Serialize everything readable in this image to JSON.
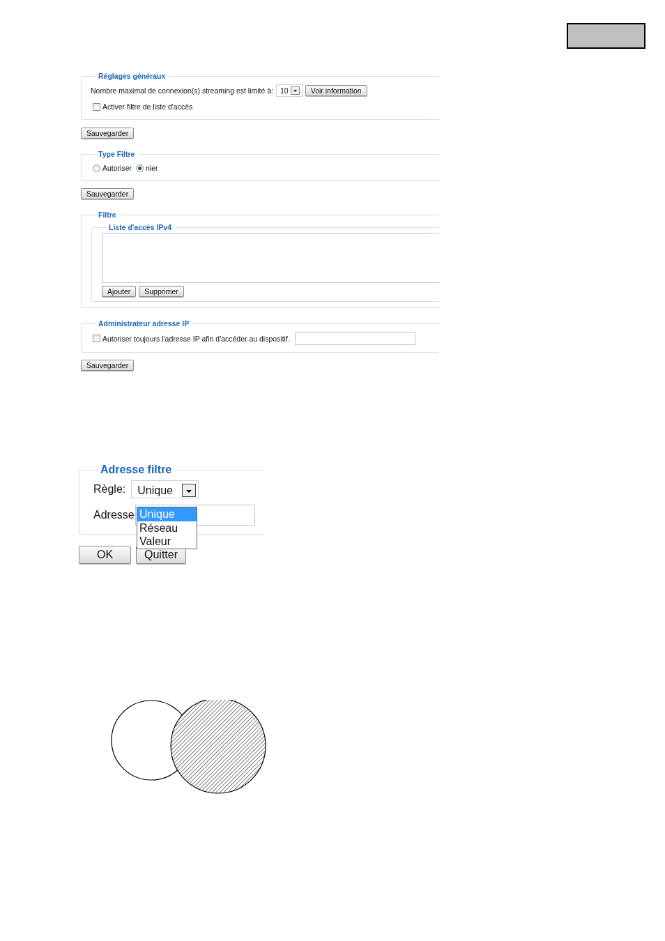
{
  "general_settings": {
    "title": "Réglages généraux",
    "max_connections_label": "Nombre maximal de connexion(s) streaming est limité à:",
    "max_connections_value": "10",
    "info_button": "Voir information",
    "access_filter": {
      "label": "Activer filtre de liste d'accès",
      "checked": false
    },
    "save_button": "Sauvegarder"
  },
  "filter_type": {
    "title": "Type Filtre",
    "options": [
      {
        "label": "Autoriser",
        "selected": false
      },
      {
        "label": "nier",
        "selected": true
      }
    ],
    "save_button": "Sauvegarder"
  },
  "filter": {
    "title": "Filtre",
    "ipv4_list": {
      "title": "Liste d'accès IPv4",
      "buttons": [
        "Ajouter",
        "Supprimer"
      ]
    }
  },
  "admin_ip": {
    "title": "Administrateur adresse IP",
    "always_allow": {
      "label": "Autoriser toujours l'adresse IP afin d'accéder au dispositif.",
      "checked": false
    },
    "save_button": "Sauvegarder"
  },
  "address_filter_dialog": {
    "title": "Adresse filtre",
    "rule_label": "Règle:",
    "rule_value": "Unique",
    "rule_options": [
      {
        "label": "Unique",
        "selected": true
      },
      {
        "label": "Réseau",
        "selected": false
      },
      {
        "label": "Valeur",
        "selected": false
      }
    ],
    "address_label": "Adresse",
    "buttons": [
      "OK",
      "Quitter"
    ]
  }
}
